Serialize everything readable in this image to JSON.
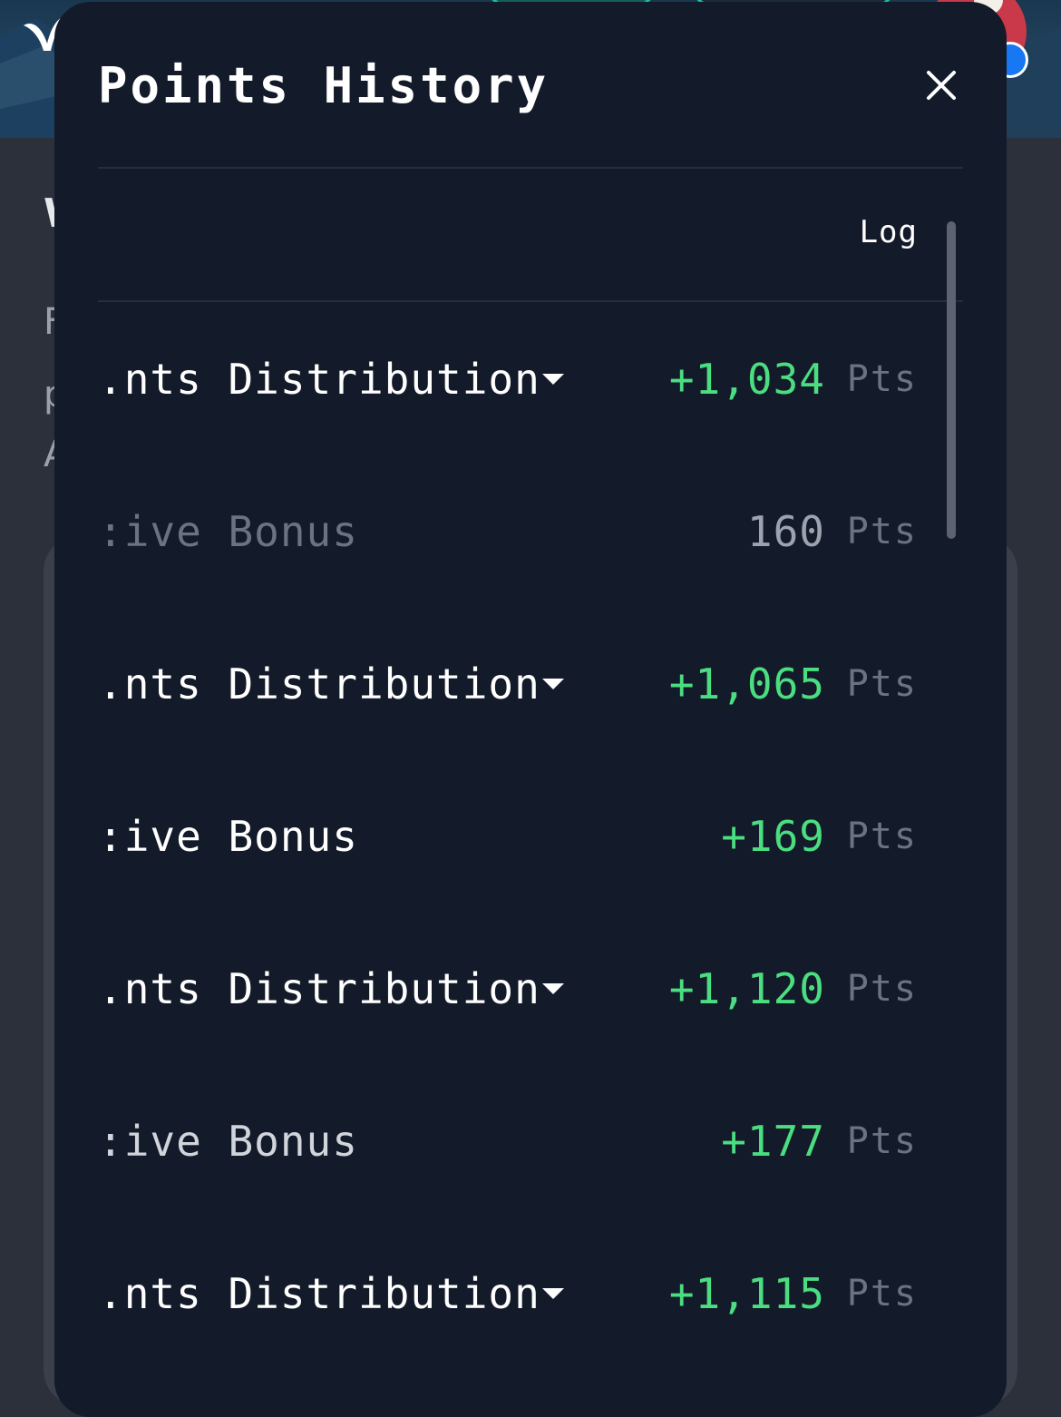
{
  "background": {
    "title": "W",
    "lines": [
      "F",
      "p",
      "A"
    ]
  },
  "modal": {
    "title": "Points History",
    "close_icon": "close-icon",
    "column_header": "Log"
  },
  "rows": [
    {
      "title": "Points Distribution",
      "shown": ".nts Distribution",
      "value": "+1,034",
      "unit": "Pts",
      "expandable": true,
      "style": "normal"
    },
    {
      "title": "Active Bonus",
      "shown": ":ive Bonus",
      "value": "160",
      "unit": "Pts",
      "expandable": false,
      "style": "faded"
    },
    {
      "title": "Points Distribution",
      "shown": ".nts Distribution",
      "value": "+1,065",
      "unit": "Pts",
      "expandable": true,
      "style": "normal"
    },
    {
      "title": "Active Bonus",
      "shown": ":ive Bonus",
      "value": "+169",
      "unit": "Pts",
      "expandable": false,
      "style": "normal"
    },
    {
      "title": "Points Distribution",
      "shown": ".nts Distribution",
      "value": "+1,120",
      "unit": "Pts",
      "expandable": true,
      "style": "normal"
    },
    {
      "title": "Active Bonus",
      "shown": ":ive Bonus",
      "value": "+177",
      "unit": "Pts",
      "expandable": false,
      "style": "dim"
    },
    {
      "title": "Points Distribution",
      "shown": ".nts Distribution",
      "value": "+1,115",
      "unit": "Pts",
      "expandable": true,
      "style": "normal"
    }
  ],
  "colors": {
    "positive": "#4ade80",
    "modal_bg": "#131a29",
    "muted": "#6b7280"
  }
}
